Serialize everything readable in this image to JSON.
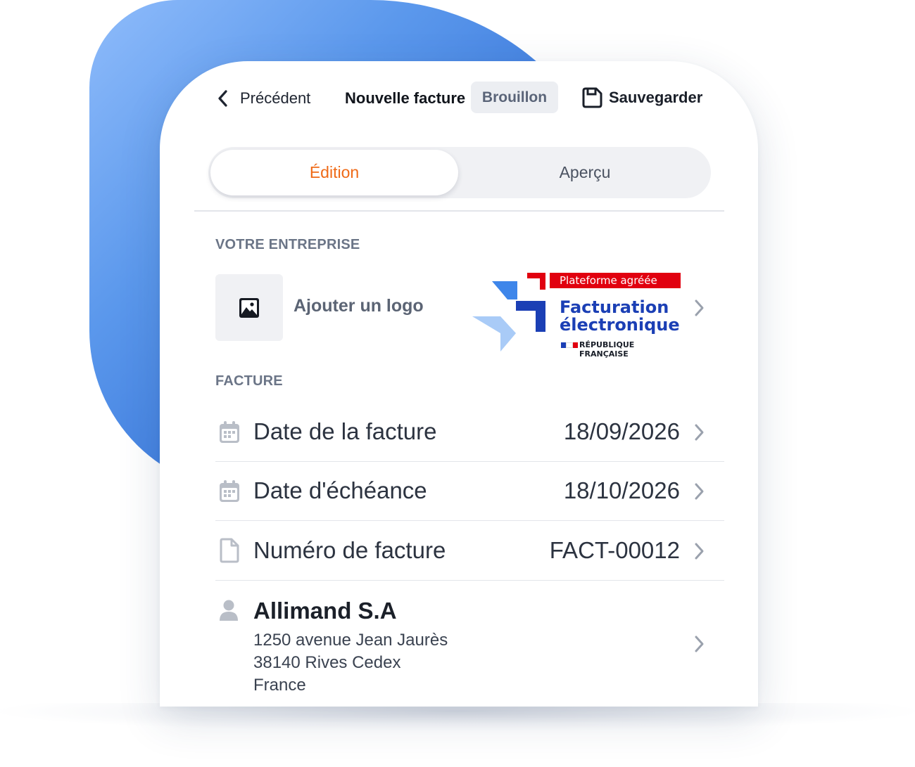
{
  "header": {
    "back_label": "Précédent",
    "title": "Nouvelle facture",
    "status_badge": "Brouillon",
    "save_label": "Sauvegarder"
  },
  "tabs": {
    "edit_label": "Édition",
    "preview_label": "Aperçu",
    "active": "edit"
  },
  "company": {
    "section_title": "VOTRE ENTREPRISE",
    "add_logo_label": "Ajouter un logo",
    "platform_badge": {
      "ribbon": "Plateforme agréée",
      "line1": "Facturation",
      "line2": "électronique",
      "footer": "RÉPUBLIQUE FRANÇAISE"
    }
  },
  "invoice": {
    "section_title": "FACTURE",
    "rows": [
      {
        "label": "Date de la facture",
        "value": "18/09/2026",
        "icon": "calendar-icon"
      },
      {
        "label": "Date d'échéance",
        "value": "18/10/2026",
        "icon": "calendar-icon"
      },
      {
        "label": "Numéro de facture",
        "value": "FACT-00012",
        "icon": "document-icon"
      }
    ]
  },
  "client": {
    "name": "Allimand S.A",
    "address": [
      "1250 avenue Jean Jaurès",
      "38140 Rives Cedex",
      "France"
    ],
    "icon": "person-icon"
  },
  "colors": {
    "accent": "#ef6a17",
    "background_blob_start": "#8fbcfb",
    "background_blob_end": "#2259b8",
    "text_primary": "#2c3340",
    "text_muted": "#6b7587",
    "republic_blue": "#1b3fb5",
    "republic_red": "#e1000f"
  }
}
